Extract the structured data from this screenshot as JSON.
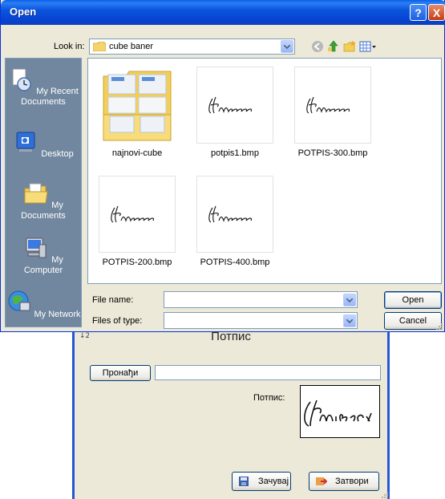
{
  "open_dialog": {
    "title": "Open",
    "look_in": {
      "label": "Look in:",
      "value": "cube baner"
    },
    "places": [
      {
        "label": "My Recent Documents",
        "icon": "recent-documents-icon"
      },
      {
        "label": "Desktop",
        "icon": "desktop-icon"
      },
      {
        "label": "My Documents",
        "icon": "my-documents-icon"
      },
      {
        "label": "My Computer",
        "icon": "my-computer-icon"
      },
      {
        "label": "My Network",
        "icon": "my-network-icon"
      }
    ],
    "files": [
      {
        "name": "najnovi-cube",
        "type": "folder"
      },
      {
        "name": "potpis1.bmp",
        "type": "image"
      },
      {
        "name": "POTPIS-300.bmp",
        "type": "image"
      },
      {
        "name": "POTPIS-200.bmp",
        "type": "image"
      },
      {
        "name": "POTPIS-400.bmp",
        "type": "image"
      }
    ],
    "file_name": {
      "label": "File name:",
      "value": ""
    },
    "files_of_type": {
      "label": "Files of type:",
      "value": ""
    },
    "buttons": {
      "open": "Open",
      "cancel": "Cancel"
    },
    "title_buttons": {
      "help": "?",
      "close": "X"
    }
  },
  "signature_dialog": {
    "title": "Потпис",
    "find_button": "Пронађи",
    "path_value": "",
    "signature_label": "Потпис:",
    "save_button": "Зачувај",
    "close_button": "Затвори"
  },
  "colors": {
    "titlebar": "#0a55dc",
    "dialog_bg": "#ece9d8",
    "places_bg": "#71879f"
  }
}
